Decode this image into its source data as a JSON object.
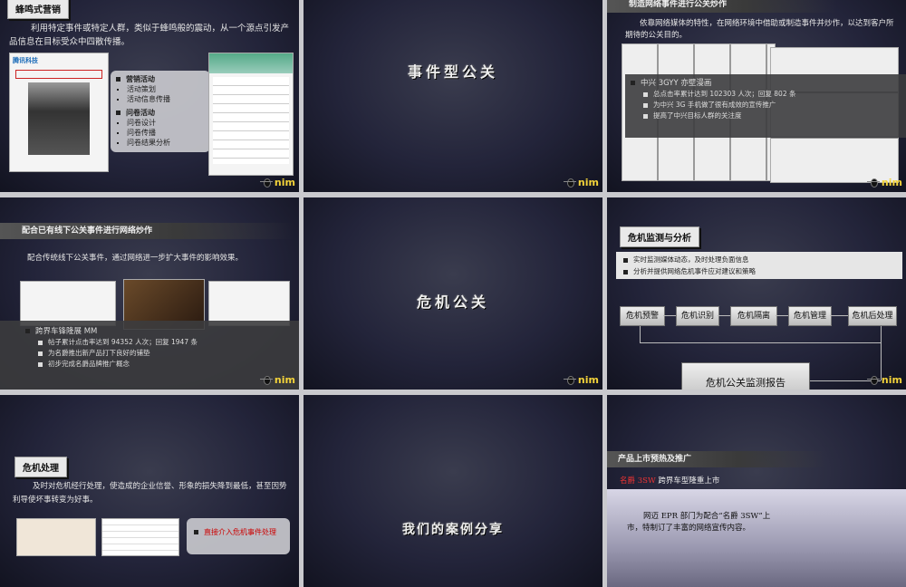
{
  "slides": [
    {
      "title": "蜂鸣式营销",
      "body": "利用特定事件或特定人群，类似于蜂鸣般的震动，从一个源点引发产品信息在目标受众中四散传播。",
      "thumb_brand": "腾讯科技",
      "menu": {
        "group1": "营销活动",
        "group1_items": [
          "活动策划",
          "活动信息传播"
        ],
        "group2": "问卷活动",
        "group2_items": [
          "问卷设计",
          "问卷传播",
          "问卷结果分析"
        ]
      }
    },
    {
      "title": "事件型公关"
    },
    {
      "title": "制造网络事件进行公关炒作",
      "body": "依靠网络媒体的特性，在网络环境中借助或制造事件并炒作，以达到客户所期待的公关目的。",
      "overlay_heading": "中兴 3GYY 亦壁漫画",
      "overlay_items": [
        "总点击率累计达到 102303 人次；回复 802 条",
        "为中兴 3G 手机做了很有成效的宣传推广",
        "提高了中兴目标人群的关注度"
      ]
    },
    {
      "title": "配合已有线下公关事件进行网络炒作",
      "body": "配合传统线下公关事件，通过网络进一步扩大事件的影响效果。",
      "overlay_heading": "跨界车锋隆展 MM",
      "overlay_items": [
        "帖子累计点击率达到 94352 人次；回复 1947 条",
        "为名爵推出新产品打下良好的铺垫",
        "初步完成名爵品牌推广概念"
      ]
    },
    {
      "title": "危机公关"
    },
    {
      "title": "危机监测与分析",
      "items": [
        "实时监测媒体动态，及时处理负面信息",
        "分析并提供网络危机事件应对建议和策略"
      ],
      "flow": [
        "危机预警",
        "危机识别",
        "危机隔离",
        "危机管理",
        "危机后处理"
      ],
      "report": "危机公关监测报告"
    },
    {
      "title": "危机处理",
      "body": "及时对危机经行处理，使造成的企业信誉、形象的损失降到最低，甚至因势利导使坏事转变为好事。",
      "panel_item": "直接介入危机事件处理"
    },
    {
      "title": "我们的案例分享"
    },
    {
      "title": "产品上市预热及推广",
      "subtitle_brand": "名爵",
      "subtitle_model": "3SW",
      "subtitle_rest": "跨界车型隆重上市",
      "body": "网迈 EPR 部门为配合“名爵 3SW”上市，特制订了丰富的网络宣传内容。"
    }
  ],
  "logo_text": "nim"
}
